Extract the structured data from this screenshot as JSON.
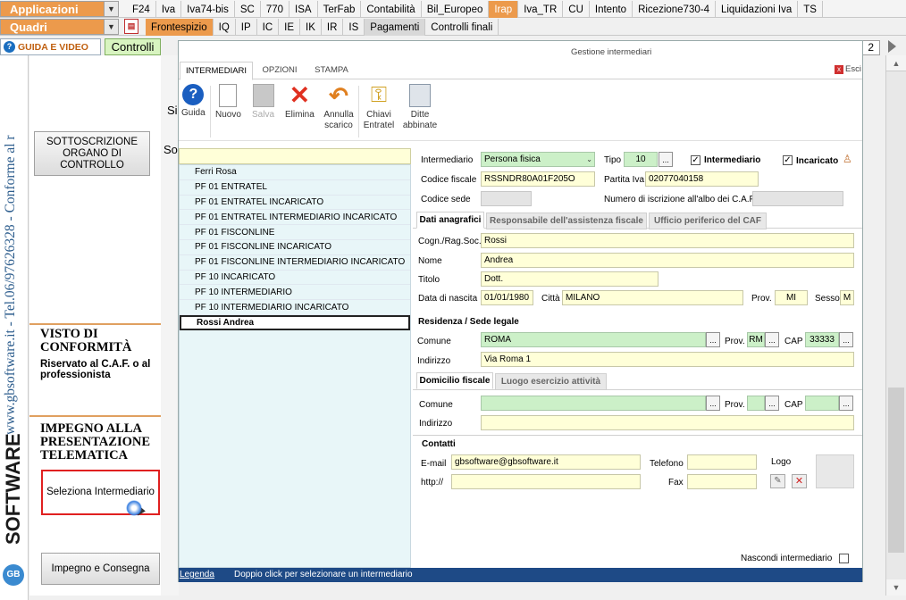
{
  "topbar": {
    "app_combo": "Applicazioni",
    "quadri_combo": "Quadri",
    "guida_label": "GUIDA E VIDEO",
    "controlli_label": "Controlli",
    "page_number": "2",
    "tabs1": [
      "F24",
      "Iva",
      "Iva74-bis",
      "SC",
      "770",
      "ISA",
      "TerFab",
      "Contabilità",
      "Bil_Europeo",
      "Irap",
      "Iva_TR",
      "CU",
      "Intento",
      "Ricezione730-4",
      "Liquidazioni Iva",
      "TS"
    ],
    "tabs2": [
      "Frontespizio",
      "IQ",
      "IP",
      "IC",
      "IE",
      "IK",
      "IR",
      "IS",
      "Pagamenti",
      "Controlli finali"
    ]
  },
  "sidebar": {
    "vert_text": "www.gbsoftware.it - Tel.06/97626328 - Conforme al r",
    "logo_text": "SOFTWARE",
    "logo_gb": "GB"
  },
  "frontespizio": {
    "sottoscrizione": "SOTTOSCRIZIONE ORGANO DI CONTROLLO",
    "visto_title": "VISTO DI CONFORMITÀ",
    "visto_sub": "Riservato al C.A.F. o al professionista",
    "impegno_title": "IMPEGNO ALLA PRESENTAZIONE TELEMATICA",
    "seleziona_btn": "Seleziona Intermediario",
    "impegno_btn": "Impegno e Consegna",
    "frag_si": "Si",
    "frag_so": "So"
  },
  "dialog": {
    "title": "Gestione intermediari",
    "esci": "Esci",
    "tabs": [
      "INTERMEDIARI",
      "OPZIONI",
      "STAMPA"
    ],
    "toolbar": {
      "guida": "Guida",
      "nuovo": "Nuovo",
      "salva": "Salva",
      "elimina": "Elimina",
      "annulla": "Annulla scarico",
      "chiavi": "Chiavi Entratel",
      "ditte": "Ditte abbinate"
    },
    "list": [
      "Ferri Rosa",
      "PF 01 ENTRATEL",
      "PF 01 ENTRATEL INCARICATO",
      "PF 01 ENTRATEL INTERMEDIARIO INCARICATO",
      "PF 01 FISCONLINE",
      "PF 01 FISCONLINE INCARICATO",
      "PF 01 FISCONLINE INTERMEDIARIO INCARICATO",
      "PF 10 INCARICATO",
      "PF 10 INTERMEDIARIO",
      "PF 10 INTERMEDIARIO INCARICATO",
      "Rossi Andrea"
    ],
    "form": {
      "intermediario_label": "Intermediario",
      "intermediario_value": "Persona fisica",
      "tipo_label": "Tipo",
      "tipo_value": "10",
      "chk_intermediario": "Intermediario",
      "chk_incaricato": "Incaricato",
      "cf_label": "Codice fiscale",
      "cf_value": "RSSNDR80A01F205O",
      "piva_label": "Partita Iva",
      "piva_value": "02077040158",
      "sede_label": "Codice sede",
      "albo_label": "Numero di iscrizione all'albo dei C.A.F.",
      "subtabs": [
        "Dati anagrafici",
        "Responsabile dell'assistenza fiscale",
        "Ufficio periferico del CAF"
      ],
      "cognome_label": "Cogn./Rag.Soc.",
      "cognome_value": "Rossi",
      "nome_label": "Nome",
      "nome_value": "Andrea",
      "titolo_label": "Titolo",
      "titolo_value": "Dott.",
      "nascita_label": "Data di nascita",
      "nascita_value": "01/01/1980",
      "citta_label": "Città",
      "citta_value": "MILANO",
      "prov_label": "Prov.",
      "prov_value": "MI",
      "sesso_label": "Sesso",
      "sesso_value": "M",
      "residenza_header": "Residenza / Sede legale",
      "comune_label": "Comune",
      "comune_value": "ROMA",
      "prov2_value": "RM",
      "cap_label": "CAP",
      "cap_value": "33333",
      "indirizzo_label": "Indirizzo",
      "indirizzo_value": "Via Roma 1",
      "domtabs": [
        "Domicilio fiscale",
        "Luogo esercizio attività"
      ],
      "contatti_header": "Contatti",
      "email_label": "E-mail",
      "email_value": "gbsoftware@gbsoftware.it",
      "telefono_label": "Telefono",
      "logo_label": "Logo",
      "http_label": "http://",
      "fax_label": "Fax",
      "nascondi_label": "Nascondi intermediario"
    },
    "status": {
      "legenda": "Legenda",
      "hint": "Doppio click per selezionare un intermediario"
    }
  }
}
